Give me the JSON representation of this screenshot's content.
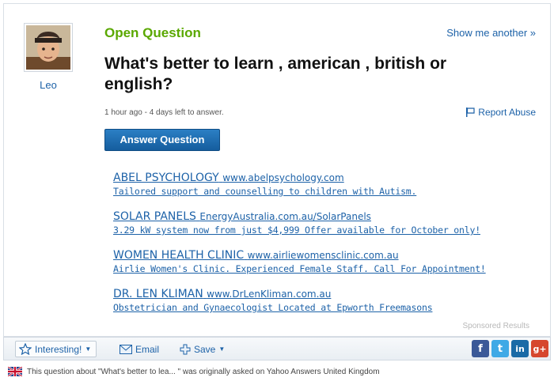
{
  "question": {
    "status": "Open Question",
    "show_another": "Show me another »",
    "title": "What's better to learn , american , british or english?",
    "meta": "1 hour ago - 4 days left to answer.",
    "report_abuse": "Report Abuse",
    "answer_button": "Answer Question"
  },
  "asker": {
    "name": "Leo"
  },
  "ads": [
    {
      "title": "ABEL PSYCHOLOGY",
      "url": "www.abelpsychology.com",
      "desc": "Tailored support and counselling to children with Autism."
    },
    {
      "title": "SOLAR PANELS",
      "url": "EnergyAustralia.com.au/SolarPanels",
      "desc": "3.29 kW system now from just $4,999 Offer available for October only!"
    },
    {
      "title": "WOMEN HEALTH CLINIC",
      "url": "www.airliewomensclinic.com.au",
      "desc": "Airlie Women's Clinic. Experienced Female Staff. Call For Appointment!"
    },
    {
      "title": "DR. LEN KLIMAN",
      "url": "www.DrLenKliman.com.au",
      "desc": "Obstetrician and Gynaecologist Located at Epworth Freemasons"
    }
  ],
  "sponsored_label": "Sponsored Results",
  "actions": {
    "interesting": "Interesting!",
    "email": "Email",
    "save": "Save"
  },
  "social": {
    "facebook": "f",
    "twitter": "t",
    "linkedin": "in",
    "googleplus": "g+"
  },
  "origin_note": "This question about \"What's better to lea... \" was originally asked on Yahoo Answers United Kingdom",
  "icons": [
    "avatar",
    "flag-icon",
    "star-icon",
    "email-icon",
    "plus-icon",
    "caret-down-icon",
    "uk-flag-icon"
  ],
  "colors": {
    "open_question_green": "#5aa800",
    "link_blue": "#1d62a8",
    "button_blue": "#155d9e"
  }
}
